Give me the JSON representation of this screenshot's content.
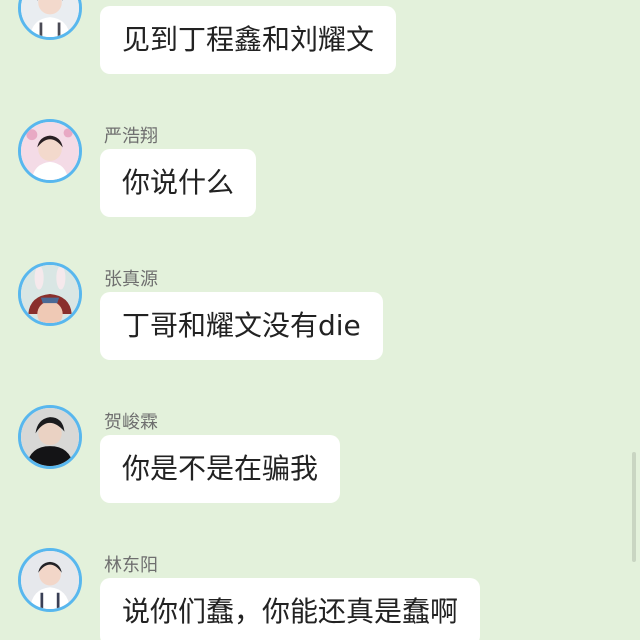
{
  "messages": [
    {
      "name": "",
      "text": "见到丁程鑫和刘耀文",
      "avatar_icon": "user-avatar-icon"
    },
    {
      "name": "严浩翔",
      "text": "你说什么",
      "avatar_icon": "user-avatar-icon"
    },
    {
      "name": "张真源",
      "text": "丁哥和耀文没有die",
      "avatar_icon": "user-avatar-icon"
    },
    {
      "name": "贺峻霖",
      "text": "你是不是在骗我",
      "avatar_icon": "user-avatar-icon"
    },
    {
      "name": "林东阳",
      "text": "说你们蠢，你能还真是蠢啊",
      "avatar_icon": "user-avatar-icon"
    }
  ],
  "colors": {
    "background": "#e3f1db",
    "bubble": "#ffffff",
    "avatar_ring": "#58b7ee",
    "name_text": "#6f6f6f",
    "message_text": "#222222"
  }
}
